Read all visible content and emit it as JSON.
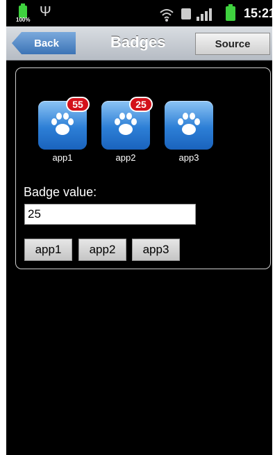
{
  "status_bar": {
    "battery_level": "100%",
    "time": "15:21"
  },
  "nav": {
    "back_label": "Back",
    "title": "Badges",
    "source_label": "Source"
  },
  "apps": [
    {
      "label": "app1",
      "badge": "55"
    },
    {
      "label": "app2",
      "badge": "25"
    },
    {
      "label": "app3",
      "badge": ""
    }
  ],
  "form": {
    "badge_value_label": "Badge value:",
    "badge_value": "25"
  },
  "buttons": [
    "app1",
    "app2",
    "app3"
  ],
  "colors": {
    "badge_red": "#d3111a",
    "icon_blue": "#2d7fd6",
    "battery_green": "#3fd23f"
  }
}
